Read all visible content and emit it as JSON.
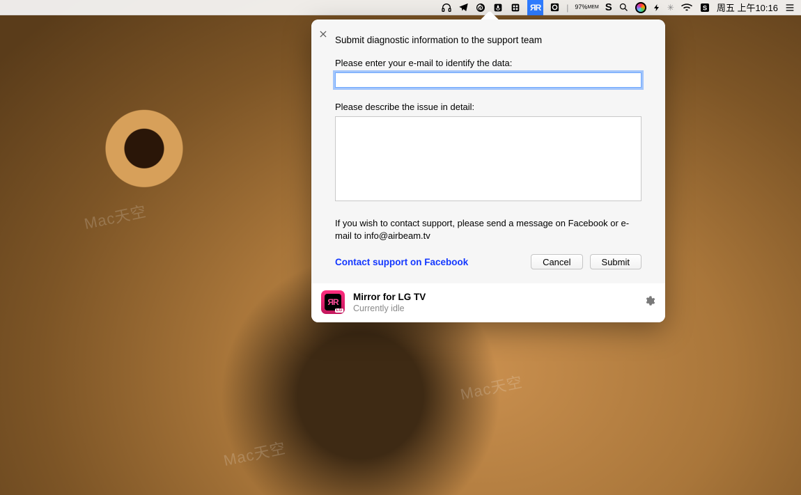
{
  "menubar": {
    "app_logo_text": "ЯR",
    "battery_percent": "97%",
    "battery_sub": "MEM",
    "clock": "周五 上午10:16"
  },
  "popover": {
    "heading": "Submit diagnostic information to the support team",
    "email_label": "Please enter your e-mail to identify the data:",
    "email_value": "",
    "desc_label": "Please describe the issue in detail:",
    "desc_value": "",
    "note": "If you wish to contact support, please send a message on Facebook or e-mail to info@airbeam.tv",
    "facebook_link": "Contact support on Facebook",
    "cancel": "Cancel",
    "submit": "Submit"
  },
  "app": {
    "icon_text": "ЯR",
    "icon_badge": "LG",
    "name": "Mirror for LG TV",
    "status": "Currently idle"
  },
  "watermark": "Mac天空"
}
